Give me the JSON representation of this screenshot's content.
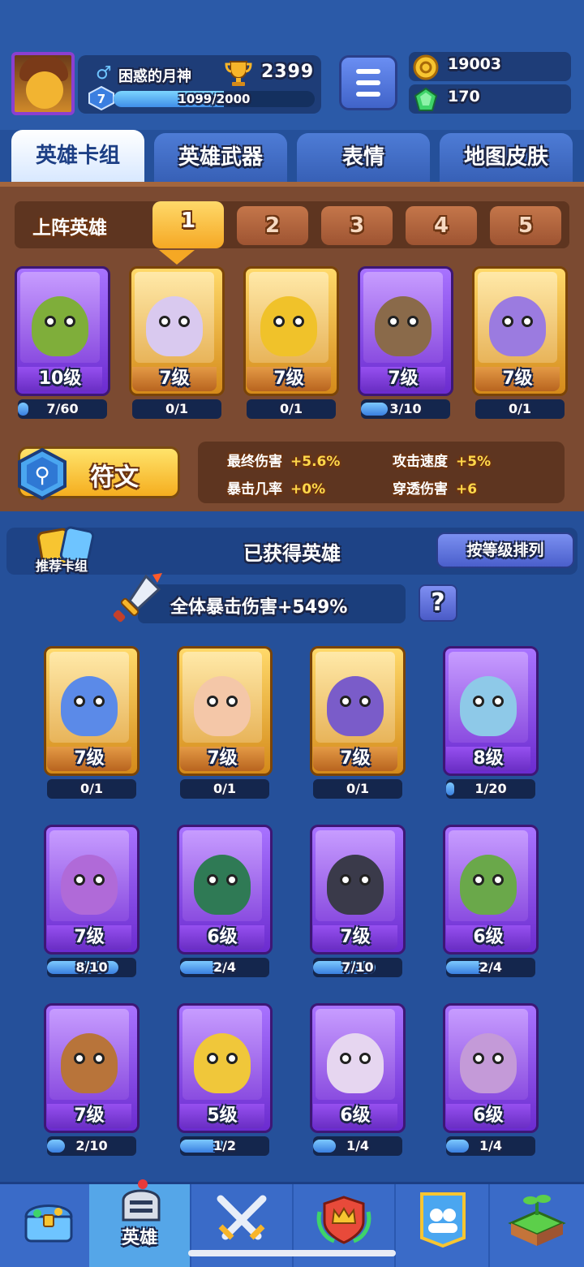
{
  "player": {
    "name": "困惑的月神",
    "gender_icon": "male-icon",
    "level": "7",
    "xp_text": "1099/2000",
    "xp_fraction": 0.55,
    "trophies": "2399"
  },
  "currency": {
    "gold": "19003",
    "gems": "170"
  },
  "tabs": [
    {
      "label": "英雄卡组",
      "active": true
    },
    {
      "label": "英雄武器",
      "active": false
    },
    {
      "label": "表情",
      "active": false
    },
    {
      "label": "地图皮肤",
      "active": false
    }
  ],
  "deck": {
    "label": "上阵英雄",
    "slots": [
      "1",
      "2",
      "3",
      "4",
      "5"
    ],
    "active_slot": "1",
    "heroes": [
      {
        "level": "10级",
        "progress": "7/60",
        "fraction": 0.12,
        "rarity": "purple",
        "color": "#7fae3a"
      },
      {
        "level": "7级",
        "progress": "0/1",
        "fraction": 0,
        "rarity": "gold",
        "color": "#d9c9ef"
      },
      {
        "level": "7级",
        "progress": "0/1",
        "fraction": 0,
        "rarity": "gold",
        "color": "#f0c22a"
      },
      {
        "level": "7级",
        "progress": "3/10",
        "fraction": 0.3,
        "rarity": "purple",
        "color": "#8a6a4a"
      },
      {
        "level": "7级",
        "progress": "0/1",
        "fraction": 0,
        "rarity": "gold",
        "color": "#9b7be0"
      }
    ]
  },
  "rune": {
    "label": "符文",
    "stats": [
      {
        "name": "最终伤害",
        "value": "+5.6%"
      },
      {
        "name": "攻击速度",
        "value": "+5%"
      },
      {
        "name": "暴击几率",
        "value": "+0%"
      },
      {
        "name": "穿透伤害",
        "value": "+6"
      }
    ]
  },
  "owned": {
    "recommend_label": "推荐卡组",
    "title": "已获得英雄",
    "sort_label": "按等级排列",
    "crit_text": "全体暴击伤害+549%",
    "help_label": "?",
    "heroes": [
      {
        "level": "7级",
        "progress": "0/1",
        "fraction": 0,
        "rarity": "gold",
        "color": "#5b8ae8"
      },
      {
        "level": "7级",
        "progress": "0/1",
        "fraction": 0,
        "rarity": "gold",
        "color": "#f4c7a8"
      },
      {
        "level": "7级",
        "progress": "0/1",
        "fraction": 0,
        "rarity": "gold",
        "color": "#7a5cc9"
      },
      {
        "level": "8级",
        "progress": "1/20",
        "fraction": 0.05,
        "rarity": "purple",
        "color": "#8ec9e8"
      },
      {
        "level": "7级",
        "progress": "8/10",
        "fraction": 0.8,
        "rarity": "purple",
        "color": "#b06ad8"
      },
      {
        "level": "6级",
        "progress": "2/4",
        "fraction": 0.5,
        "rarity": "purple",
        "color": "#2f7a55"
      },
      {
        "level": "7级",
        "progress": "7/10",
        "fraction": 0.7,
        "rarity": "purple",
        "color": "#3a3a4a"
      },
      {
        "level": "6级",
        "progress": "2/4",
        "fraction": 0.5,
        "rarity": "purple",
        "color": "#6aa84a"
      },
      {
        "level": "7级",
        "progress": "2/10",
        "fraction": 0.2,
        "rarity": "purple",
        "color": "#b8743a"
      },
      {
        "level": "5级",
        "progress": "1/2",
        "fraction": 0.5,
        "rarity": "purple",
        "color": "#f0c73a"
      },
      {
        "level": "6级",
        "progress": "1/4",
        "fraction": 0.25,
        "rarity": "purple",
        "color": "#e6d6f0"
      },
      {
        "level": "6级",
        "progress": "1/4",
        "fraction": 0.25,
        "rarity": "purple",
        "color": "#c49ad8"
      }
    ]
  },
  "nav": [
    {
      "icon": "treasure-chest-icon",
      "label": "",
      "active": false
    },
    {
      "icon": "knight-helmet-icon",
      "label": "英雄",
      "active": true
    },
    {
      "icon": "crossed-swords-icon",
      "label": "",
      "active": false
    },
    {
      "icon": "crown-shield-icon",
      "label": "",
      "active": false
    },
    {
      "icon": "team-banner-icon",
      "label": "",
      "active": false
    },
    {
      "icon": "grass-island-icon",
      "label": "",
      "active": false
    }
  ]
}
